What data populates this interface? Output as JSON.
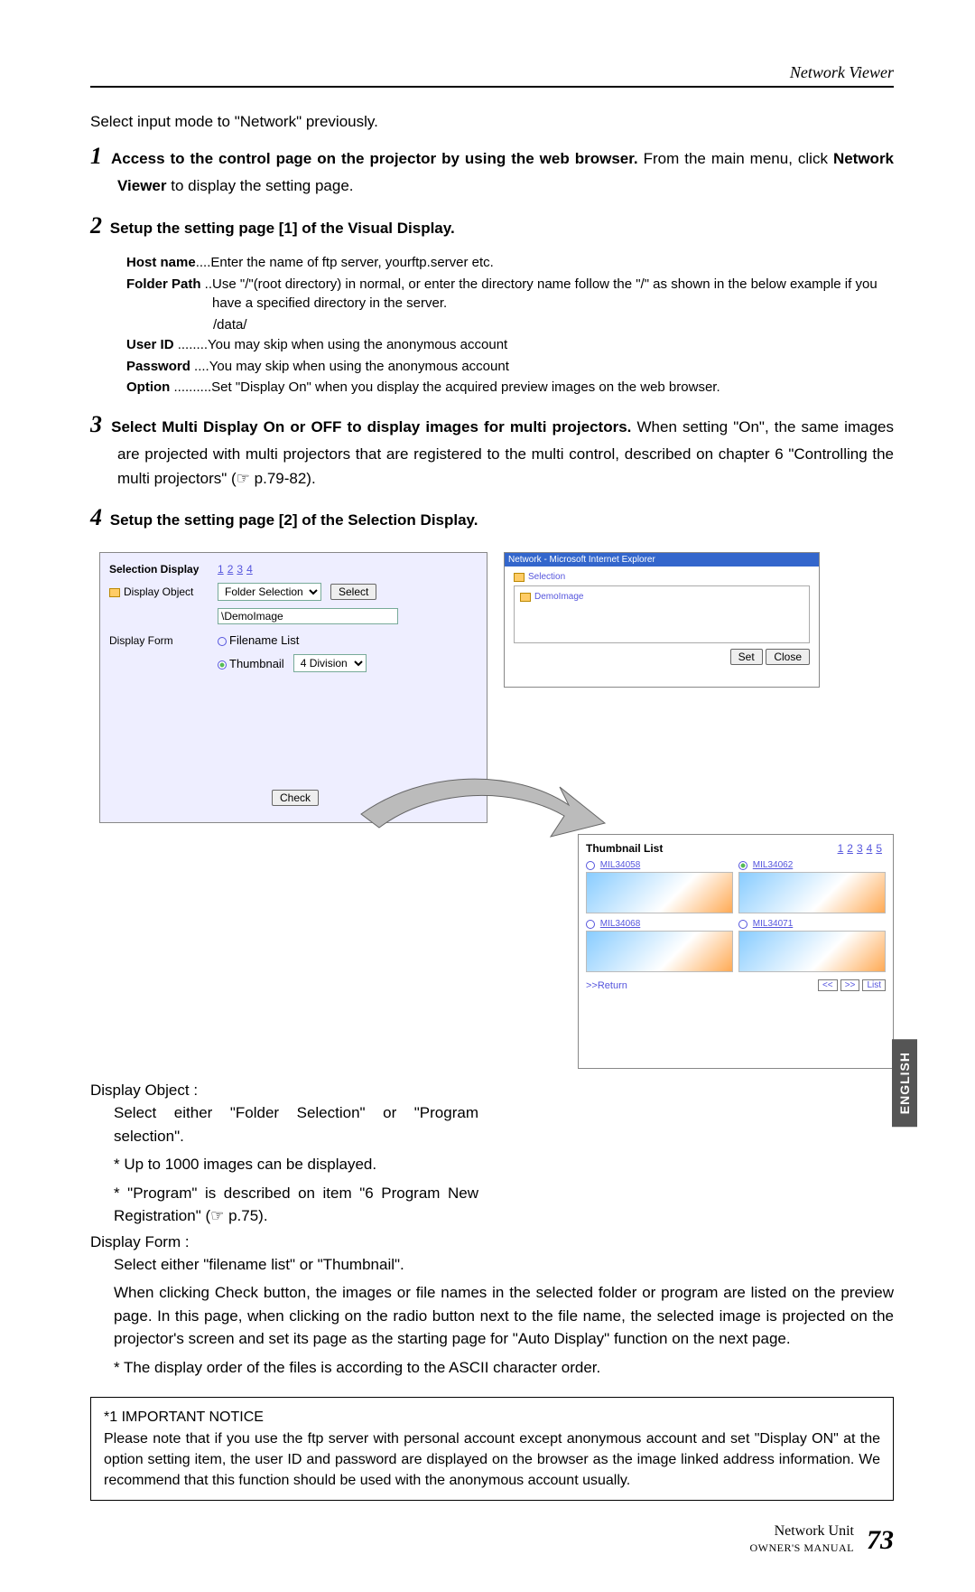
{
  "header": {
    "title": "Network Viewer"
  },
  "intro": "Select input mode to \"Network\" previously.",
  "steps": {
    "s1": {
      "num": "1",
      "bold": "Access to the control page on the projector by using the web browser.",
      "rest": " From the main menu, click ",
      "nv": "Network Viewer",
      "rest2": " to display the setting page."
    },
    "s2": {
      "num": "2",
      "bold": "Setup the setting page [1] of the Visual Display."
    },
    "s3": {
      "num": "3",
      "bold": "Select Multi Display On or OFF to display images for multi projectors.",
      "rest": " When setting \"On\", the same images are projected with multi projectors that are registered to the multi control, described on chapter 6 \"Controlling the multi projectors\" (☞ p.79-82)."
    },
    "s4": {
      "num": "4",
      "bold": "Setup the setting page [2] of the Selection Display."
    }
  },
  "defs": {
    "host": {
      "term": "Host name",
      "dots": "....",
      "val": "Enter the name of ftp server, yourftp.server etc."
    },
    "folder": {
      "term": "Folder Path",
      "dots": " ..",
      "val": "Use \"/\"(root directory) in normal, or enter the directory name follow the \"/\" as shown in the below example if you have a specified directory in the server.",
      "extra": "/data/"
    },
    "user": {
      "term": "User ID",
      "dots": " ........",
      "val": "You may skip when using the anonymous account"
    },
    "pass": {
      "term": "Password",
      "dots": " ....",
      "val": "You may skip when using the anonymous account"
    },
    "option": {
      "term": "Option",
      "dots": " ..........",
      "val": "Set \"Display On\" when you display the acquired preview images on the web browser."
    }
  },
  "panel1": {
    "selection_display": "Selection Display",
    "pages": [
      "1",
      "2",
      "3",
      "4"
    ],
    "display_object_label": "Display Object",
    "folder_selection": "Folder Selection",
    "select_btn": "Select",
    "path_value": "\\DemoImage",
    "display_form_label": "Display Form",
    "filename_list": "Filename List",
    "thumbnail": "Thumbnail",
    "thumb_division": "4 Division",
    "check_btn": "Check"
  },
  "popup": {
    "title": "Network - Microsoft Internet Explorer",
    "tab": "Selection",
    "item": "DemoImage",
    "set": "Set",
    "close": "Close"
  },
  "thumbpanel": {
    "title": "Thumbnail List",
    "pages": [
      "1",
      "2",
      "3",
      "4",
      "5"
    ],
    "items": [
      "MIL34058",
      "MIL34062",
      "MIL34068",
      "MIL34071"
    ],
    "return": ">>Return",
    "prev": "<<",
    "next": ">>",
    "list": "List"
  },
  "body2": {
    "do_head": "Display Object :",
    "do_l1": "Select either \"Folder Selection\" or \"Program selection\".",
    "do_l2": "* Up to 1000 images can be displayed.",
    "do_l3": "* \"Program\" is described on item \"6 Program New Registration\" (☞ p.75).",
    "df_head": "Display Form :",
    "df_l1": "Select either \"filename list\" or \"Thumbnail\".",
    "para": "When clicking Check button, the images or file names in the selected folder or program are listed on the preview page. In this page, when clicking on the radio button next to the file name, the selected image is projected on the projector's screen and set its page as the starting page for \"Auto Display\" function on the next page.",
    "note": "* The display order of the files is according to the ASCII character order."
  },
  "notice": {
    "head": "*1 IMPORTANT NOTICE",
    "body": "Please note that if you use the ftp server with personal account except anonymous account and set \"Display ON\" at the option setting item, the user ID and password are displayed on the browser as the image linked address information. We recommend that this function should be used with the anonymous account usually."
  },
  "footer": {
    "label": "Network Unit",
    "sub": "OWNER'S MANUAL",
    "page": "73"
  },
  "side": "ENGLISH"
}
